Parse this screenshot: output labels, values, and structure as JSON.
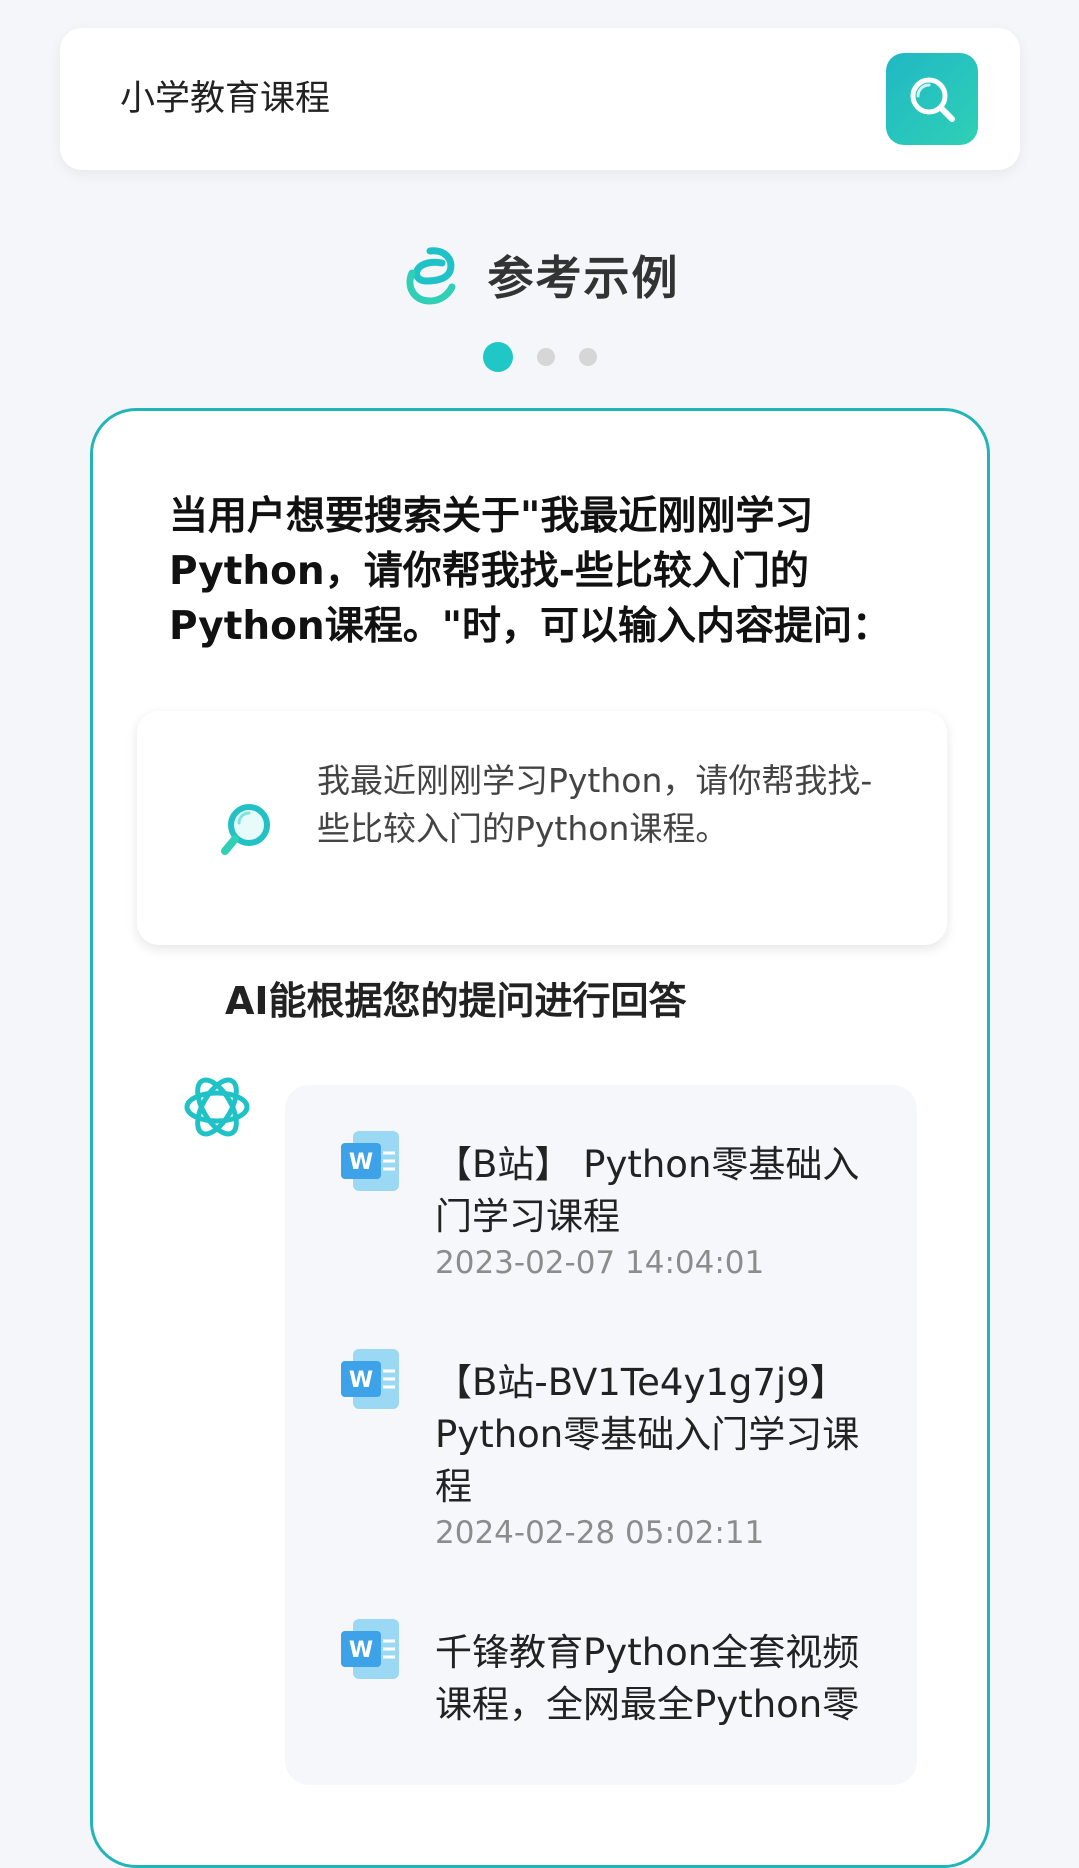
{
  "search": {
    "query": "小学教育课程",
    "button_icon": "search-icon"
  },
  "section": {
    "title": "参考示例",
    "icon": "link-e-icon"
  },
  "pager": {
    "total": 3,
    "active_index": 0
  },
  "example": {
    "intro": "当用户想要搜索关于\"我最近刚刚学习Python，请你帮我找-些比较入门的Python课程。\"时，可以输入内容提问：",
    "query_text": "我最近刚刚学习Python，请你帮我找-些比较入门的Python课程。",
    "answer_label": "AI能根据您的提问进行回答",
    "results": [
      {
        "title": "【B站】 Python零基础入门学习课程",
        "date": "2023-02-07 14:04:01",
        "icon": "word-doc-icon"
      },
      {
        "title": "【B站-BV1Te4y1g7j9】Python零基础入门学习课程",
        "date": "2024-02-28 05:02:11",
        "icon": "word-doc-icon"
      },
      {
        "title": "千锋教育Python全套视频课程，全网最全Python零",
        "date": "",
        "icon": "word-doc-icon"
      }
    ]
  },
  "colors": {
    "accent": "#1fc7c7",
    "card_border": "#22b5b8",
    "background": "#f4f6f9"
  }
}
